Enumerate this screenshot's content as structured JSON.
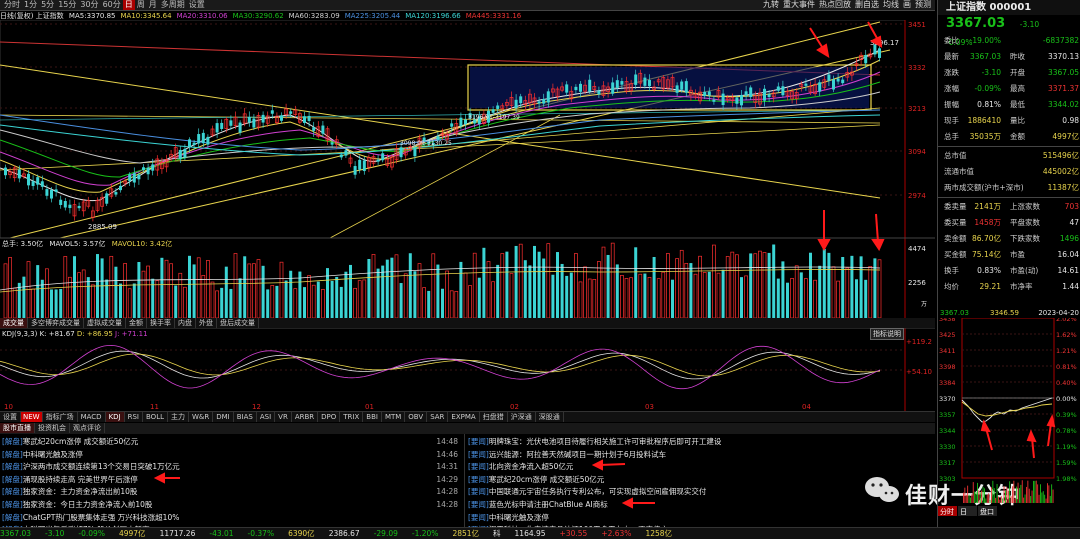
{
  "topbar": {
    "tabs": [
      "分时",
      "1分",
      "5分",
      "15分",
      "30分",
      "60分",
      "日",
      "周",
      "月",
      "多周期",
      "设置"
    ],
    "active_tab": "日",
    "right_items": [
      "九转",
      "重大事件",
      "热点回放",
      "删自选",
      "均线",
      "画",
      "预测"
    ]
  },
  "ma_line": {
    "label": "日线(复权) 上证指数",
    "items": [
      {
        "k": "MA5:",
        "v": "3370.85",
        "color": "#e6e6e6"
      },
      {
        "k": "MA10:",
        "v": "3345.64",
        "color": "#e8d44d"
      },
      {
        "k": "MA20:",
        "v": "3310.06",
        "color": "#d040d0"
      },
      {
        "k": "MA30:",
        "v": "3290.62",
        "color": "#19c019"
      },
      {
        "k": "MA60:",
        "v": "3283.09",
        "color": "#d0d0d0"
      },
      {
        "k": "MA225:",
        "v": "3205.44",
        "color": "#4a8fe0"
      },
      {
        "k": "MA120:",
        "v": "3196.66",
        "color": "#3bd4d4"
      },
      {
        "k": "MA445:",
        "v": "3331.16",
        "color": "#e33"
      }
    ]
  },
  "main_chart": {
    "y_ticks": [
      "3451",
      "3332",
      "3213",
      "3094",
      "2974"
    ],
    "annotations": [
      "3396.17",
      "2885.09",
      "3196.91-3197.39",
      "3098.09-3130.25"
    ]
  },
  "volume": {
    "label": "总手: 3.50亿",
    "mavol5": "MAVOL5: 3.57亿",
    "mavol10": "MAVOL10: 3.42亿",
    "y_ticks": [
      "4474",
      "2256"
    ],
    "unit": "万"
  },
  "mid_buttons": [
    "成交量",
    "多空博弈成交量",
    "虚拟成交量",
    "金额",
    "换手率",
    "内盘",
    "外盘",
    "盘后成交量"
  ],
  "kdj": {
    "label": "KDJ(9,3,3)",
    "k": "K: +81.67",
    "d": "D: +86.95",
    "j": "J: +71.11",
    "explain": "指标说明",
    "y_ticks": [
      "+119.2",
      "+54.10"
    ],
    "x_ticks": [
      "10",
      "11",
      "12",
      "01",
      "02",
      "03",
      "04"
    ]
  },
  "indicator_bar": [
    "设置",
    "NEW",
    "指标广场",
    "MACD",
    "KDJ",
    "RSI",
    "BOLL",
    "主力",
    "W&R",
    "DMI",
    "BIAS",
    "ASI",
    "VR",
    "ARBR",
    "DPO",
    "TRIX",
    "BBI",
    "MTM",
    "OBV",
    "SAR",
    "EXPMA",
    "扫盘猎",
    "沪深通",
    "深股通"
  ],
  "indicator_selected": "KDJ",
  "news_tabs": [
    "股市直播",
    "投资机会",
    "观点评论"
  ],
  "news_left": [
    {
      "tag": "[解盘]",
      "text": "寒武纪20cm涨停 成交额近50亿元",
      "time": "14:48"
    },
    {
      "tag": "[解盘]",
      "text": "中科曙光触及涨停",
      "time": "14:46"
    },
    {
      "tag": "[解盘]",
      "text": "沪深两市成交额连续第13个交易日突破1万亿元",
      "time": "14:31"
    },
    {
      "tag": "[解盘]",
      "text": "涌现股持续走高 完美世界午后涨停",
      "time": "14:29"
    },
    {
      "tag": "[解盘]",
      "text": "独家资金：主力资金净流出前10股",
      "time": "14:28"
    },
    {
      "tag": "[解盘]",
      "text": "独家资金：今日主力资金净流入前10股",
      "time": "14:28"
    },
    {
      "tag": "[解盘]",
      "text": "ChatGPT热门股票集体走强 万兴科技涨超10%",
      "time": ""
    },
    {
      "tag": "[解盘]",
      "text": "中科曙光午后涨超7% 股价创历史新高",
      "time": ""
    }
  ],
  "news_right": [
    {
      "tag": "[要闻]",
      "text": "明牌珠宝：光伏电池项目待履行相关施工许可审批程序后即可开工建设"
    },
    {
      "tag": "[要闻]",
      "text": "远兴能源：阿拉善天然碱项目一期计划于6月投料试车"
    },
    {
      "tag": "[要闻]",
      "text": "北向资金净流入超50亿元"
    },
    {
      "tag": "[要闻]",
      "text": "寒武纪20cm涨停 成交额近50亿元"
    },
    {
      "tag": "[要闻]",
      "text": "中国联通元宇宙任务执行专利公布，可实现虚拟空间雇佣现实交付"
    },
    {
      "tag": "[要闻]",
      "text": "蓝色光标申请注册ChatBlue AI商标"
    },
    {
      "tag": "[要闻]",
      "text": "中科曙光触及涨停"
    },
    {
      "tag": "[要闻]",
      "text": "汉王科技：生产该产品认证100天多天左右，否定传言"
    }
  ],
  "right_panel": {
    "title": "上证指数 000001",
    "price": "3367.03",
    "change": "-3.10",
    "change_pct": "-0.09%",
    "rows": [
      {
        "l1": "委比",
        "v1": "-19.00%",
        "c1": "g",
        "l2": "",
        "v2": "-6837382",
        "c2": "g"
      },
      {
        "l1": "最新",
        "v1": "3367.03",
        "c1": "g",
        "l2": "昨收",
        "v2": "3370.13",
        "c2": "w"
      },
      {
        "l1": "涨跌",
        "v1": "-3.10",
        "c1": "g",
        "l2": "开盘",
        "v2": "3367.05",
        "c2": "g"
      },
      {
        "l1": "涨幅",
        "v1": "-0.09%",
        "c1": "g",
        "l2": "最高",
        "v2": "3371.37",
        "c2": "r"
      },
      {
        "l1": "振幅",
        "v1": "0.81%",
        "c1": "w",
        "l2": "最低",
        "v2": "3344.02",
        "c2": "g"
      },
      {
        "l1": "现手",
        "v1": "1886410",
        "c1": "y",
        "l2": "量比",
        "v2": "0.98",
        "c2": "w"
      },
      {
        "l1": "总手",
        "v1": "35035万",
        "c1": "y",
        "l2": "金额",
        "v2": "4997亿",
        "c2": "y"
      },
      {
        "l1": "总市值",
        "v1": "",
        "c1": "w",
        "l2": "",
        "v2": "515496亿",
        "c2": "y"
      },
      {
        "l1": "流通市值",
        "v1": "",
        "c1": "w",
        "l2": "",
        "v2": "445002亿",
        "c2": "y"
      },
      {
        "l1": "两市成交额(沪市+深市)",
        "v1": "",
        "c1": "w",
        "l2": "",
        "v2": "11387亿",
        "c2": "y"
      },
      {
        "l1": "委卖量",
        "v1": "2141万",
        "c1": "y",
        "l2": "上涨家数",
        "v2": "703",
        "c2": "r"
      },
      {
        "l1": "委买量",
        "v1": "1458万",
        "c1": "r",
        "l2": "平盘家数",
        "v2": "47",
        "c2": "w"
      },
      {
        "l1": "卖金额",
        "v1": "86.70亿",
        "c1": "y",
        "l2": "下跌家数",
        "v2": "1496",
        "c2": "g"
      },
      {
        "l1": "买金额",
        "v1": "75.14亿",
        "c1": "y",
        "l2": "市盈",
        "v2": "16.04",
        "c2": "w"
      },
      {
        "l1": "换手",
        "v1": "0.83%",
        "c1": "w",
        "l2": "市盈(动)",
        "v2": "14.61",
        "c2": "w"
      },
      {
        "l1": "均价",
        "v1": "29.21",
        "c1": "y",
        "l2": "市净率",
        "v2": "1.44",
        "c2": "w"
      }
    ]
  },
  "mini_chart": {
    "header_left": "3367.03",
    "header_mid": "3346.59",
    "header_right": "2023-04-20",
    "y_left": [
      "3438",
      "3425",
      "3411",
      "3398",
      "3384",
      "3370",
      "3357",
      "3344",
      "3330",
      "3317",
      "3303"
    ],
    "y_right": [
      "2.02%",
      "1.62%",
      "1.21%",
      "0.81%",
      "0.40%",
      "0.00%",
      "0.39%",
      "0.78%",
      "1.19%",
      "1.59%",
      "1.98%"
    ],
    "tabs": [
      "分时",
      "日",
      "盘口"
    ],
    "selected_tab": "分时"
  },
  "statusbar": [
    {
      "t": "3367.03",
      "c": "g"
    },
    {
      "t": "-3.10",
      "c": "g"
    },
    {
      "t": "-0.09%",
      "c": "g"
    },
    {
      "t": "4997亿",
      "c": "y"
    },
    {
      "t": "11717.26",
      "c": "w"
    },
    {
      "t": "-43.01",
      "c": "g"
    },
    {
      "t": "-0.37%",
      "c": "g"
    },
    {
      "t": "6390亿",
      "c": "y"
    },
    {
      "t": "2386.67",
      "c": "w"
    },
    {
      "t": "-29.09",
      "c": "g"
    },
    {
      "t": "-1.20%",
      "c": "g"
    },
    {
      "t": "2851亿",
      "c": "y"
    },
    {
      "t": "科",
      "c": "w"
    },
    {
      "t": "1164.95",
      "c": "w"
    },
    {
      "t": "+30.55",
      "c": "r"
    },
    {
      "t": "+2.63%",
      "c": "r"
    },
    {
      "t": "1258亿",
      "c": "y"
    }
  ],
  "watermark": "佳财一分钟"
}
